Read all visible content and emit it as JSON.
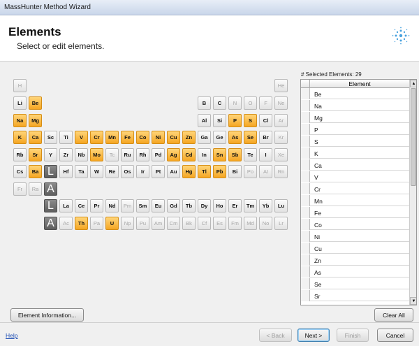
{
  "window": {
    "title": "MassHunter Method Wizard"
  },
  "header": {
    "title": "Elements",
    "subtitle": "Select or edit elements."
  },
  "periodic_table": {
    "lanthanide_placeholder": "L",
    "actinide_placeholder": "A",
    "cells": [
      {
        "s": "H",
        "r": 0,
        "c": 0,
        "sel": false,
        "dis": true
      },
      {
        "s": "He",
        "r": 0,
        "c": 17,
        "sel": false,
        "dis": true
      },
      {
        "s": "Li",
        "r": 1,
        "c": 0,
        "sel": false,
        "dis": false
      },
      {
        "s": "Be",
        "r": 1,
        "c": 1,
        "sel": true,
        "dis": false
      },
      {
        "s": "B",
        "r": 1,
        "c": 12,
        "sel": false,
        "dis": false
      },
      {
        "s": "C",
        "r": 1,
        "c": 13,
        "sel": false,
        "dis": false
      },
      {
        "s": "N",
        "r": 1,
        "c": 14,
        "sel": false,
        "dis": true
      },
      {
        "s": "O",
        "r": 1,
        "c": 15,
        "sel": false,
        "dis": true
      },
      {
        "s": "F",
        "r": 1,
        "c": 16,
        "sel": false,
        "dis": true
      },
      {
        "s": "Ne",
        "r": 1,
        "c": 17,
        "sel": false,
        "dis": true
      },
      {
        "s": "Na",
        "r": 2,
        "c": 0,
        "sel": true,
        "dis": false
      },
      {
        "s": "Mg",
        "r": 2,
        "c": 1,
        "sel": true,
        "dis": false
      },
      {
        "s": "Al",
        "r": 2,
        "c": 12,
        "sel": false,
        "dis": false
      },
      {
        "s": "Si",
        "r": 2,
        "c": 13,
        "sel": false,
        "dis": false
      },
      {
        "s": "P",
        "r": 2,
        "c": 14,
        "sel": true,
        "dis": false
      },
      {
        "s": "S",
        "r": 2,
        "c": 15,
        "sel": true,
        "dis": false
      },
      {
        "s": "Cl",
        "r": 2,
        "c": 16,
        "sel": false,
        "dis": false
      },
      {
        "s": "Ar",
        "r": 2,
        "c": 17,
        "sel": false,
        "dis": true
      },
      {
        "s": "K",
        "r": 3,
        "c": 0,
        "sel": true,
        "dis": false
      },
      {
        "s": "Ca",
        "r": 3,
        "c": 1,
        "sel": true,
        "dis": false
      },
      {
        "s": "Sc",
        "r": 3,
        "c": 2,
        "sel": false,
        "dis": false
      },
      {
        "s": "Ti",
        "r": 3,
        "c": 3,
        "sel": false,
        "dis": false
      },
      {
        "s": "V",
        "r": 3,
        "c": 4,
        "sel": true,
        "dis": false
      },
      {
        "s": "Cr",
        "r": 3,
        "c": 5,
        "sel": true,
        "dis": false
      },
      {
        "s": "Mn",
        "r": 3,
        "c": 6,
        "sel": true,
        "dis": false
      },
      {
        "s": "Fe",
        "r": 3,
        "c": 7,
        "sel": true,
        "dis": false
      },
      {
        "s": "Co",
        "r": 3,
        "c": 8,
        "sel": true,
        "dis": false
      },
      {
        "s": "Ni",
        "r": 3,
        "c": 9,
        "sel": true,
        "dis": false
      },
      {
        "s": "Cu",
        "r": 3,
        "c": 10,
        "sel": true,
        "dis": false
      },
      {
        "s": "Zn",
        "r": 3,
        "c": 11,
        "sel": true,
        "dis": false
      },
      {
        "s": "Ga",
        "r": 3,
        "c": 12,
        "sel": false,
        "dis": false
      },
      {
        "s": "Ge",
        "r": 3,
        "c": 13,
        "sel": false,
        "dis": false
      },
      {
        "s": "As",
        "r": 3,
        "c": 14,
        "sel": true,
        "dis": false
      },
      {
        "s": "Se",
        "r": 3,
        "c": 15,
        "sel": true,
        "dis": false
      },
      {
        "s": "Br",
        "r": 3,
        "c": 16,
        "sel": false,
        "dis": false
      },
      {
        "s": "Kr",
        "r": 3,
        "c": 17,
        "sel": false,
        "dis": true
      },
      {
        "s": "Rb",
        "r": 4,
        "c": 0,
        "sel": false,
        "dis": false
      },
      {
        "s": "Sr",
        "r": 4,
        "c": 1,
        "sel": true,
        "dis": false
      },
      {
        "s": "Y",
        "r": 4,
        "c": 2,
        "sel": false,
        "dis": false
      },
      {
        "s": "Zr",
        "r": 4,
        "c": 3,
        "sel": false,
        "dis": false
      },
      {
        "s": "Nb",
        "r": 4,
        "c": 4,
        "sel": false,
        "dis": false
      },
      {
        "s": "Mo",
        "r": 4,
        "c": 5,
        "sel": true,
        "dis": false
      },
      {
        "s": "Tc",
        "r": 4,
        "c": 6,
        "sel": false,
        "dis": true
      },
      {
        "s": "Ru",
        "r": 4,
        "c": 7,
        "sel": false,
        "dis": false
      },
      {
        "s": "Rh",
        "r": 4,
        "c": 8,
        "sel": false,
        "dis": false
      },
      {
        "s": "Pd",
        "r": 4,
        "c": 9,
        "sel": false,
        "dis": false
      },
      {
        "s": "Ag",
        "r": 4,
        "c": 10,
        "sel": true,
        "dis": false
      },
      {
        "s": "Cd",
        "r": 4,
        "c": 11,
        "sel": true,
        "dis": false
      },
      {
        "s": "In",
        "r": 4,
        "c": 12,
        "sel": false,
        "dis": false
      },
      {
        "s": "Sn",
        "r": 4,
        "c": 13,
        "sel": true,
        "dis": false
      },
      {
        "s": "Sb",
        "r": 4,
        "c": 14,
        "sel": true,
        "dis": false
      },
      {
        "s": "Te",
        "r": 4,
        "c": 15,
        "sel": false,
        "dis": false
      },
      {
        "s": "I",
        "r": 4,
        "c": 16,
        "sel": false,
        "dis": false
      },
      {
        "s": "Xe",
        "r": 4,
        "c": 17,
        "sel": false,
        "dis": true
      },
      {
        "s": "Cs",
        "r": 5,
        "c": 0,
        "sel": false,
        "dis": false
      },
      {
        "s": "Ba",
        "r": 5,
        "c": 1,
        "sel": true,
        "dis": false
      },
      {
        "s": "Hf",
        "r": 5,
        "c": 3,
        "sel": false,
        "dis": false
      },
      {
        "s": "Ta",
        "r": 5,
        "c": 4,
        "sel": false,
        "dis": false
      },
      {
        "s": "W",
        "r": 5,
        "c": 5,
        "sel": false,
        "dis": false
      },
      {
        "s": "Re",
        "r": 5,
        "c": 6,
        "sel": false,
        "dis": false
      },
      {
        "s": "Os",
        "r": 5,
        "c": 7,
        "sel": false,
        "dis": false
      },
      {
        "s": "Ir",
        "r": 5,
        "c": 8,
        "sel": false,
        "dis": false
      },
      {
        "s": "Pt",
        "r": 5,
        "c": 9,
        "sel": false,
        "dis": false
      },
      {
        "s": "Au",
        "r": 5,
        "c": 10,
        "sel": false,
        "dis": false
      },
      {
        "s": "Hg",
        "r": 5,
        "c": 11,
        "sel": true,
        "dis": false
      },
      {
        "s": "Tl",
        "r": 5,
        "c": 12,
        "sel": true,
        "dis": false
      },
      {
        "s": "Pb",
        "r": 5,
        "c": 13,
        "sel": true,
        "dis": false
      },
      {
        "s": "Bi",
        "r": 5,
        "c": 14,
        "sel": false,
        "dis": false
      },
      {
        "s": "Po",
        "r": 5,
        "c": 15,
        "sel": false,
        "dis": true
      },
      {
        "s": "At",
        "r": 5,
        "c": 16,
        "sel": false,
        "dis": true
      },
      {
        "s": "Rn",
        "r": 5,
        "c": 17,
        "sel": false,
        "dis": true
      },
      {
        "s": "Fr",
        "r": 6,
        "c": 0,
        "sel": false,
        "dis": true
      },
      {
        "s": "Ra",
        "r": 6,
        "c": 1,
        "sel": false,
        "dis": true
      },
      {
        "s": "La",
        "r": 7,
        "c": 3,
        "sel": false,
        "dis": false
      },
      {
        "s": "Ce",
        "r": 7,
        "c": 4,
        "sel": false,
        "dis": false
      },
      {
        "s": "Pr",
        "r": 7,
        "c": 5,
        "sel": false,
        "dis": false
      },
      {
        "s": "Nd",
        "r": 7,
        "c": 6,
        "sel": false,
        "dis": false
      },
      {
        "s": "Pm",
        "r": 7,
        "c": 7,
        "sel": false,
        "dis": true
      },
      {
        "s": "Sm",
        "r": 7,
        "c": 8,
        "sel": false,
        "dis": false
      },
      {
        "s": "Eu",
        "r": 7,
        "c": 9,
        "sel": false,
        "dis": false
      },
      {
        "s": "Gd",
        "r": 7,
        "c": 10,
        "sel": false,
        "dis": false
      },
      {
        "s": "Tb",
        "r": 7,
        "c": 11,
        "sel": false,
        "dis": false
      },
      {
        "s": "Dy",
        "r": 7,
        "c": 12,
        "sel": false,
        "dis": false
      },
      {
        "s": "Ho",
        "r": 7,
        "c": 13,
        "sel": false,
        "dis": false
      },
      {
        "s": "Er",
        "r": 7,
        "c": 14,
        "sel": false,
        "dis": false
      },
      {
        "s": "Tm",
        "r": 7,
        "c": 15,
        "sel": false,
        "dis": false
      },
      {
        "s": "Yb",
        "r": 7,
        "c": 16,
        "sel": false,
        "dis": false
      },
      {
        "s": "Lu",
        "r": 7,
        "c": 17,
        "sel": false,
        "dis": false
      },
      {
        "s": "Ac",
        "r": 8,
        "c": 3,
        "sel": false,
        "dis": true
      },
      {
        "s": "Th",
        "r": 8,
        "c": 4,
        "sel": true,
        "dis": false
      },
      {
        "s": "Pa",
        "r": 8,
        "c": 5,
        "sel": false,
        "dis": true
      },
      {
        "s": "U",
        "r": 8,
        "c": 6,
        "sel": true,
        "dis": false
      },
      {
        "s": "Np",
        "r": 8,
        "c": 7,
        "sel": false,
        "dis": true
      },
      {
        "s": "Pu",
        "r": 8,
        "c": 8,
        "sel": false,
        "dis": true
      },
      {
        "s": "Am",
        "r": 8,
        "c": 9,
        "sel": false,
        "dis": true
      },
      {
        "s": "Cm",
        "r": 8,
        "c": 10,
        "sel": false,
        "dis": true
      },
      {
        "s": "Bk",
        "r": 8,
        "c": 11,
        "sel": false,
        "dis": true
      },
      {
        "s": "Cf",
        "r": 8,
        "c": 12,
        "sel": false,
        "dis": true
      },
      {
        "s": "Es",
        "r": 8,
        "c": 13,
        "sel": false,
        "dis": true
      },
      {
        "s": "Fm",
        "r": 8,
        "c": 14,
        "sel": false,
        "dis": true
      },
      {
        "s": "Md",
        "r": 8,
        "c": 15,
        "sel": false,
        "dis": true
      },
      {
        "s": "No",
        "r": 8,
        "c": 16,
        "sel": false,
        "dis": true
      },
      {
        "s": "Lr",
        "r": 8,
        "c": 17,
        "sel": false,
        "dis": true
      }
    ]
  },
  "selected_panel": {
    "count_label": "# Selected Elements:",
    "count": "29",
    "column_header": "Element",
    "rows": [
      "Be",
      "Na",
      "Mg",
      "P",
      "S",
      "K",
      "Ca",
      "V",
      "Cr",
      "Mn",
      "Fe",
      "Co",
      "Ni",
      "Cu",
      "Zn",
      "As",
      "Se",
      "Sr"
    ]
  },
  "buttons": {
    "element_information": "Element Information...",
    "clear_all": "Clear All",
    "back": "< Back",
    "next": "Next >",
    "finish": "Finish",
    "cancel": "Cancel"
  },
  "footer": {
    "help": "Help"
  },
  "icons": {
    "logo": "spark-logo-icon",
    "scroll_up": "scroll-up-icon",
    "scroll_down": "scroll-down-icon"
  },
  "colors": {
    "selected_fill": "#f5a623",
    "placeholder_fill": "#6a6a6a",
    "link": "#1f4fb5"
  }
}
